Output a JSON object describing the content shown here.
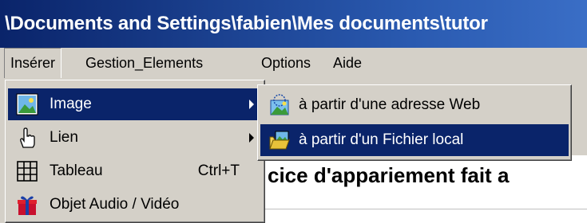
{
  "window": {
    "title": "\\Documents and Settings\\fabien\\Mes documents\\tutor"
  },
  "menubar": {
    "items": [
      {
        "label": "Insérer"
      },
      {
        "label": "Gestion_Elements"
      },
      {
        "label": "Options"
      },
      {
        "label": "Aide"
      }
    ]
  },
  "insert_menu": {
    "items": [
      {
        "label": "Image",
        "icon": "image-icon",
        "has_submenu": true,
        "shortcut": ""
      },
      {
        "label": "Lien",
        "icon": "link-hand-icon",
        "has_submenu": true,
        "shortcut": ""
      },
      {
        "label": "Tableau",
        "icon": "table-grid-icon",
        "has_submenu": false,
        "shortcut": "Ctrl+T"
      },
      {
        "label": "Objet Audio / Vidéo",
        "icon": "gift-box-icon",
        "has_submenu": false,
        "shortcut": ""
      }
    ]
  },
  "image_submenu": {
    "items": [
      {
        "label": "à partir d'une adresse Web",
        "icon": "web-image-icon"
      },
      {
        "label": "à partir d'un Fichier local",
        "icon": "folder-image-icon"
      }
    ]
  },
  "document": {
    "visible_text": "cice d'appariement fait a"
  },
  "colors": {
    "selection": "#0a246a",
    "title_start": "#0a246a",
    "title_end": "#3a6ec6",
    "face": "#d4d0c8"
  }
}
